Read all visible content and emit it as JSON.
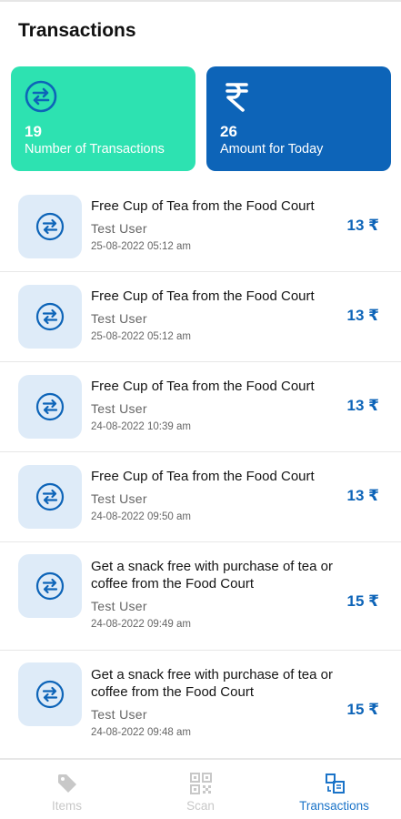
{
  "header": {
    "title": "Transactions"
  },
  "stats": [
    {
      "value": "19",
      "label": "Number of Transactions",
      "icon": "swap-icon",
      "color": "#2de2b1"
    },
    {
      "value": "26",
      "label": "Amount for Today",
      "icon": "rupee-icon",
      "color": "#0d64b8"
    }
  ],
  "transactions": [
    {
      "title": "Free Cup of Tea from the Food Court",
      "user": "Test  User",
      "time": "25-08-2022 05:12 am",
      "amount": "13 ₹"
    },
    {
      "title": "Free Cup of Tea from the Food Court",
      "user": "Test  User",
      "time": "25-08-2022 05:12 am",
      "amount": "13 ₹"
    },
    {
      "title": "Free Cup of Tea from the Food Court",
      "user": "Test  User",
      "time": "24-08-2022 10:39 am",
      "amount": "13 ₹"
    },
    {
      "title": "Free Cup of Tea from the Food Court",
      "user": "Test  User",
      "time": "24-08-2022 09:50 am",
      "amount": "13 ₹"
    },
    {
      "title": "Get a snack free with purchase of tea or coffee from the Food Court",
      "user": "Test  User",
      "time": "24-08-2022 09:49 am",
      "amount": "15 ₹"
    },
    {
      "title": "Get a snack free with purchase of tea or coffee from the Food Court",
      "user": "Test  User",
      "time": "24-08-2022 09:48 am",
      "amount": "15 ₹"
    }
  ],
  "nav": [
    {
      "label": "Items",
      "icon": "tag-icon",
      "active": false
    },
    {
      "label": "Scan",
      "icon": "qr-code-icon",
      "active": false
    },
    {
      "label": "Transactions",
      "icon": "transactions-icon",
      "active": true
    }
  ],
  "colors": {
    "accent": "#0d64b8",
    "mint": "#2de2b1",
    "icon_bg": "#deebf8",
    "nav_active": "#1a73c8",
    "nav_inactive": "#c8c8c8"
  }
}
